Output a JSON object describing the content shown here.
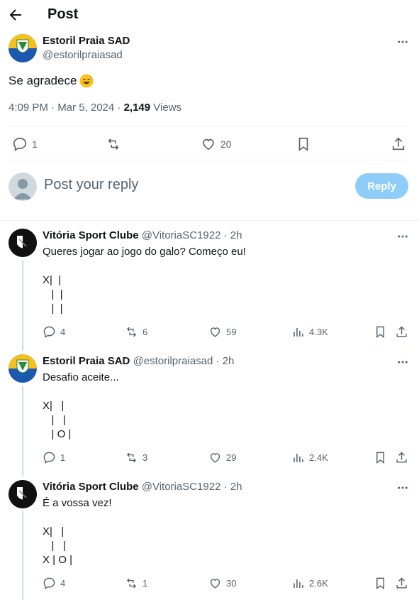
{
  "header": {
    "title": "Post"
  },
  "main_post": {
    "author": "Estoril Praia SAD",
    "handle": "@estorilpraiasad",
    "text": "Se agradece",
    "emoji": "sweat-smile-emoji",
    "time": "4:09 PM · Mar 5, 2024 · ",
    "views_count": "2,149",
    "views_label": " Views",
    "replies": "1",
    "reposts": "",
    "likes": "20"
  },
  "reply_box": {
    "placeholder": "Post your reply",
    "button": "Reply"
  },
  "replies": [
    {
      "author": "Vitória Sport Clube",
      "handle": "@VitoriaSC1922 · 2h",
      "text": "Queres jogar ao jogo do galo? Começo eu!\n\nX|  |\n   |  |\n   |  |",
      "replies": "4",
      "reposts": "6",
      "likes": "59",
      "views": "4.3K"
    },
    {
      "author": "Estoril Praia SAD",
      "handle": "@estorilpraiasad · 2h",
      "text": "Desafio aceite...\n\nX|   |\n   |   |\n   | O |",
      "replies": "1",
      "reposts": "3",
      "likes": "29",
      "views": "2.4K"
    },
    {
      "author": "Vitória Sport Clube",
      "handle": "@VitoriaSC1922 · 2h",
      "text": "É a vossa vez!\n\nX|   |\n   |   |\nX | O |",
      "replies": "4",
      "reposts": "1",
      "likes": "30",
      "views": "2.6K"
    }
  ],
  "colors": {
    "accent": "#1d9bf0",
    "reply_button": "#8ecdf8",
    "muted": "#536471"
  }
}
